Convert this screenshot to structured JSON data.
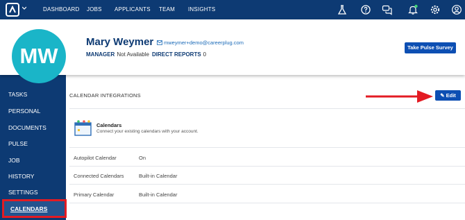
{
  "nav": {
    "items": [
      "DASHBOARD",
      "JOBS",
      "APPLICANTS",
      "TEAM",
      "INSIGHTS"
    ],
    "icons": [
      "flask-icon",
      "help-icon",
      "chat-icon",
      "bell-icon",
      "gear-icon",
      "user-icon"
    ]
  },
  "profile": {
    "initials": "MW",
    "name": "Mary Weymer",
    "email": "mweymer+demo@careerplug.com",
    "manager_label": "MANAGER",
    "manager_value": "Not Available",
    "reports_label": "DIRECT REPORTS",
    "reports_value": "0",
    "pulse_button": "Take Pulse Survey"
  },
  "sidebar": {
    "items": [
      "TASKS",
      "PERSONAL",
      "DOCUMENTS",
      "PULSE",
      "JOB",
      "HISTORY",
      "SETTINGS",
      "CALENDARS"
    ],
    "active": "CALENDARS"
  },
  "main": {
    "title": "CALENDAR INTEGRATIONS",
    "edit_label": "Edit",
    "calendars_title": "Calendars",
    "calendars_subtitle": "Connect your existing calendars with your account.",
    "rows": [
      {
        "label": "Autopilot Calendar",
        "value": "On"
      },
      {
        "label": "Connected Calendars",
        "value": "Built-in Calendar"
      },
      {
        "label": "Primary Calendar",
        "value": "Built-in Calendar"
      }
    ]
  },
  "colors": {
    "nav_bg": "#0d3a73",
    "avatar_bg": "#1ab5c8",
    "button_bg": "#0d4fb3",
    "highlight_red": "#e31b23"
  }
}
